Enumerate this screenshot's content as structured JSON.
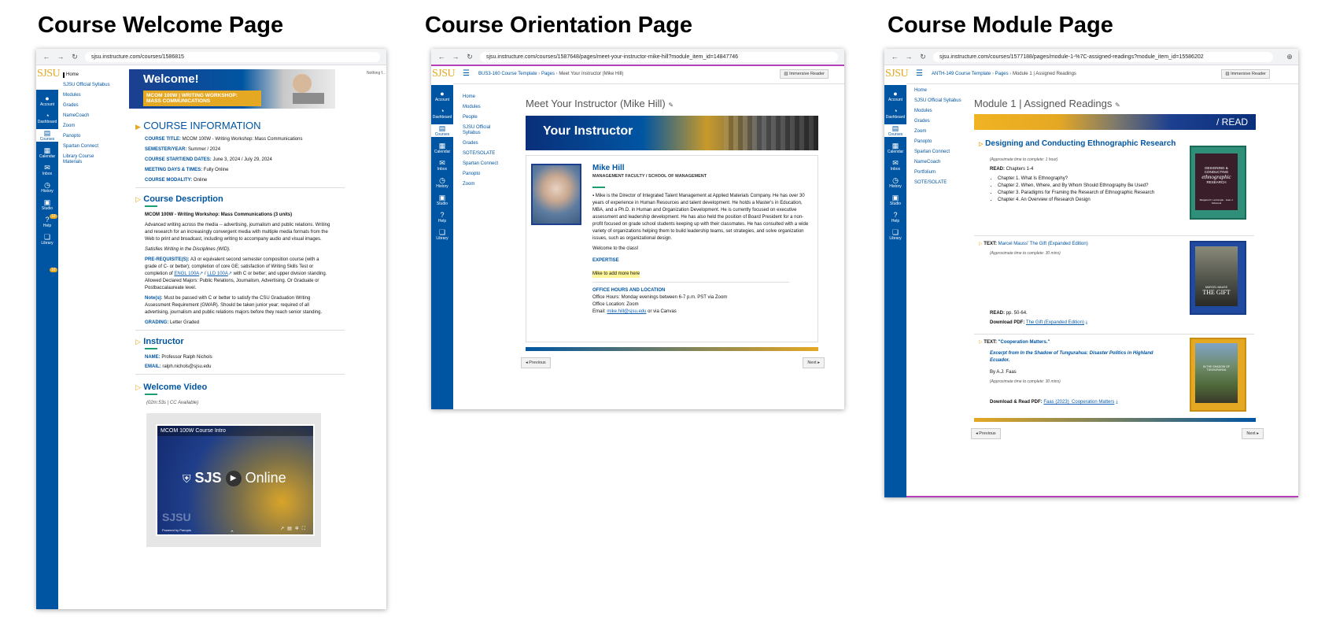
{
  "panels": [
    {
      "title": "Course Welcome Page"
    },
    {
      "title": "Course Orientation Page"
    },
    {
      "title": "Course Module Page"
    }
  ],
  "colors": {
    "sjsu_blue": "#0055a2",
    "sjsu_gold": "#e5a823",
    "accent_green": "#1a9f6e",
    "link": "#0b5cad"
  },
  "welcome": {
    "url": "sjsu.instructure.com/courses/1586815",
    "logo": "SJSU",
    "corner_text": "Nothing f...",
    "global_nav": [
      "Account",
      "Dashboard",
      "Courses",
      "Calendar",
      "Inbox",
      "History",
      "Studio",
      "Help",
      "Library"
    ],
    "global_nav_icons": [
      "account-icon",
      "dashboard-icon",
      "courses-icon",
      "calendar-icon",
      "inbox-icon",
      "history-icon",
      "studio-icon",
      "help-icon",
      "library-icon"
    ],
    "badges": {
      "inbox": "10",
      "help": "10"
    },
    "course_nav": [
      "Home",
      "SJSU Official Syllabus",
      "Modules",
      "Grades",
      "NameCoach",
      "Zoom",
      "Panopto",
      "Spartan Connect",
      "Library Course Materials"
    ],
    "banner": {
      "title": "Welcome!",
      "subtitle_1": "MCOM 100W | WRITING WORKSHOP:",
      "subtitle_2": "MASS COMMUNICATIONS"
    },
    "course_info": {
      "heading": "COURSE INFORMATION",
      "rows": [
        {
          "label": "COURSE TITLE:",
          "value": "MCOM 100W - Writing Workshop: Mass Communications"
        },
        {
          "label": "SEMESTER/YEAR:",
          "value": "Summer / 2024"
        },
        {
          "label": "COURSE START/END DATES:",
          "value": "June 3, 2024 / July 29, 2024"
        },
        {
          "label": "MEETING DAYS & TIMES:",
          "value": "Fully Online"
        },
        {
          "label": "COURSE MODALITY:",
          "value": "Online"
        }
      ]
    },
    "description": {
      "heading": "Course Description",
      "course_name": "MCOM 100W - Writing Workshop: Mass Communications (3 units)",
      "body": "Advanced writing across the media -- advertising, journalism and public relations. Writing and research for an increasingly convergent media with multiple media formats from the Web to print and broadcast, including writing to accompany audio and visual images.",
      "satisfies": "Satisfies Writing in the Disciplines (WID).",
      "prereq_label": "PRE-REQUISITE(S):",
      "prereq_text_1": "A3 or equivalent second semester composition course (with a grade of C- or better); completion of core GE; satisfaction of Writing Skills Test or completion of",
      "prereq_link_1": "ENGL 100A",
      "prereq_sep": "/",
      "prereq_link_2": "LLD 100A",
      "prereq_text_2": "with C or better; and upper division standing. Allowed Declared Majors: Public Relations, Journalism, Advertising. Or Graduate or Postbaccalaureate level.",
      "notes_label": "Note(s):",
      "notes_text": "Must be passed with C or better to satisfy the CSU Graduation Writing Assessment Requirement (GWAR). Should be taken junior year; required of all advertising, journalism and public relations majors before they reach senior standing.",
      "grading_label": "GRADING:",
      "grading_value": "Letter Graded"
    },
    "instructor": {
      "heading": "Instructor",
      "name_label": "NAME:",
      "name_value": "Professor Ralph Nichols",
      "email_label": "EMAIL:",
      "email_value": "ralph.nichols@sjsu.edu"
    },
    "video": {
      "heading": "Welcome Video",
      "meta": "(02m:53s | CC Available)",
      "player_title": "MCOM 100W Course Intro",
      "brand_1": "SJS",
      "brand_2": "Online",
      "watermark": "SJSU",
      "powered": "Powered by Panopto"
    }
  },
  "orientation": {
    "url": "sjsu.instructure.com/courses/1587648/pages/meet-your-instructor-mike-hill?module_item_id=14847746",
    "logo": "SJSU",
    "breadcrumb": [
      "BUS3-160 Course Template",
      "Pages",
      "Meet Your Instructor (Mike Hill)"
    ],
    "immersive_reader": "Immersive Reader",
    "global_nav": [
      "Account",
      "Dashboard",
      "Courses",
      "Calendar",
      "Inbox",
      "History",
      "Studio",
      "Help",
      "Library"
    ],
    "global_nav_icons": [
      "account-icon",
      "dashboard-icon",
      "courses-icon",
      "calendar-icon",
      "inbox-icon",
      "history-icon",
      "studio-icon",
      "help-icon",
      "library-icon"
    ],
    "course_nav": [
      "Home",
      "Modules",
      "People",
      "SJSU Official Syllabus",
      "Grades",
      "SOTE/SOLATE",
      "Spartan Connect",
      "Panopto",
      "Zoom"
    ],
    "page_title": "Meet Your Instructor (Mike Hill)",
    "banner": "Your Instructor",
    "name": "Mike Hill",
    "role": "MANAGEMENT FACULTY / SCHOOL OF MANAGEMENT",
    "bio": "Mike is the Director of Integrated Talent Management at Applied Materials Company. He has over 30 years of experience in Human Resources and talent development. He holds a Master's in Education, MBA, and a Ph.D. in Human and Organization Development. He is currently focused on executive assessment and leadership development. He has also held the position of Board President for a non-profit focused on grade school students keeping up with their classmates. He has consulted with a wide variety of organizations helping them to build leadership teams, set strategies, and solve organization issues, such as organizational design.",
    "welcome": "Welcome to the class!",
    "expertise_heading": "EXPERTISE",
    "expertise_text": "Mike to add more here",
    "office_heading": "OFFICE HOURS AND LOCATION",
    "office_hours": "Office Hours: Monday evenings between 6-7 p.m. PST via Zoom",
    "office_location": "Office Location: Zoom",
    "email_prefix": "Email:",
    "email_link": "mike.hill@sjsu.edu",
    "email_suffix": "or via Canvas",
    "prev": "◂ Previous",
    "next": "Next ▸"
  },
  "module": {
    "url": "sjsu.instructure.com/courses/1577188/pages/module-1-%7C-assigned-readings?module_item_id=15586202",
    "logo": "SJSU",
    "breadcrumb": [
      "ANTH-149 Course Template",
      "Pages",
      "Module 1 | Assigned Readings"
    ],
    "immersive_reader": "Immersive Reader",
    "global_nav": [
      "Account",
      "Dashboard",
      "Courses",
      "Calendar",
      "Inbox",
      "History",
      "Studio",
      "Help",
      "Library"
    ],
    "global_nav_icons": [
      "account-icon",
      "dashboard-icon",
      "courses-icon",
      "calendar-icon",
      "inbox-icon",
      "history-icon",
      "studio-icon",
      "help-icon",
      "library-icon"
    ],
    "course_nav": [
      "Home",
      "SJSU Official Syllabus",
      "Modules",
      "Grades",
      "Zoom",
      "Panopto",
      "Spartan Connect",
      "NameCoach",
      "Portfolium",
      "SOTE/SOLATE"
    ],
    "page_title": "Module 1 | Assigned Readings",
    "banner": "/ READ",
    "reading1": {
      "title": "Designing and Conducting Ethnographic Research",
      "time": "(Approximate time to complete: 1 hour)",
      "read_label": "READ:",
      "read_value": "Chapters 1-4",
      "chapters": [
        "Chapter 1. What Is Ethnography?",
        "Chapter 2. When, Where, and By Whom Should Ethnography Be Used?",
        "Chapter 3. Paradigms for Framing the Research of Ethnographic Research",
        "Chapter 4. An Overview of Research Design"
      ],
      "cover_1": "DESIGNING & CONDUCTING",
      "cover_2": "ethnographic",
      "cover_3": "RESEARCH",
      "cover_4": "Margaret D. LeCompte · Jean J. Schensul"
    },
    "reading2": {
      "prefix": "TEXT:",
      "title": "Marcel Mauss' The Gift (Expanded Edition)",
      "time": "(Approximate time to complete: 30 mins)",
      "read_label": "READ:",
      "read_value": "pp. 50-64.",
      "download_label": "Download PDF:",
      "download_link": "The Gift (Expanded Edition)",
      "cover_1": "MARCEL MAUSS",
      "cover_2": "THE GIFT"
    },
    "reading3": {
      "prefix": "TEXT:",
      "title": "\"Cooperation Matters.\"",
      "excerpt": "Excerpt from In the Shadow of Tungurahua: Disaster Politics in Highland Ecuador.",
      "author": "By A.J. Faas",
      "time": "(Approximate time to complete: 30 mins)",
      "download_label": "Download & Read PDF:",
      "download_link": "Faas (2023)_Cooperation Matters",
      "cover_1": "IN THE SHADOW OF TUNGURAHUA"
    },
    "prev": "◂ Previous",
    "next": "Next ▸"
  }
}
